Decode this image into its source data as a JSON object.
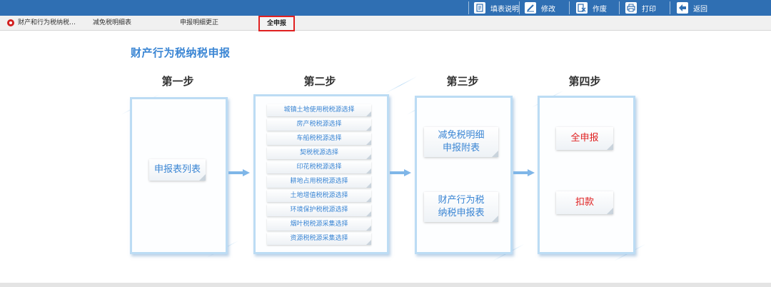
{
  "toolbar": {
    "fill_instructions": "填表说明",
    "modify": "修改",
    "void": "作废",
    "print": "打印",
    "back": "返回"
  },
  "tabs": [
    {
      "label": "财产和行为税纳税…"
    },
    {
      "label": "减免税明细表"
    },
    {
      "label": "申报明细更正"
    },
    {
      "label": "全申报",
      "active": true
    }
  ],
  "page_title": "财产行为税纳税申报",
  "steps": {
    "step1": {
      "title": "第一步",
      "cards": [
        "申报表列表"
      ]
    },
    "step2": {
      "title": "第二步",
      "items": [
        "城镇土地使用税税源选择",
        "房产税税源选择",
        "车船税税源选择",
        "契税税源选择",
        "印花税税源选择",
        "耕地占用税税源选择",
        "土地增值税税源选择",
        "环境保护税税源选择",
        "烟叶税税源采集选择",
        "资源税税源采集选择"
      ]
    },
    "step3": {
      "title": "第三步",
      "cards": [
        "减免税明细申报附表",
        "财产行为税纳税申报表"
      ]
    },
    "step4": {
      "title": "第四步",
      "cards": [
        "全申报",
        "扣款"
      ]
    }
  },
  "colors": {
    "toolbar_bg": "#2f6fb3",
    "accent_blue": "#3b86d4",
    "accent_red": "#e02020",
    "panel_border": "#bcdcf4"
  }
}
